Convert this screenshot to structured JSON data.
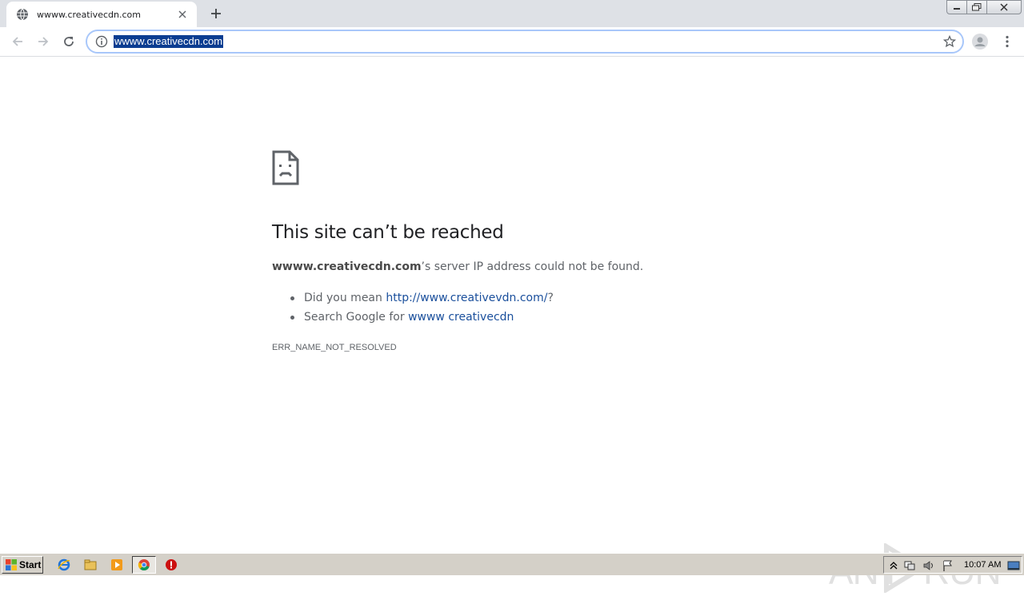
{
  "tab": {
    "title": "wwww.creativecdn.com"
  },
  "omnibox": {
    "url": "wwww.creativecdn.com"
  },
  "error": {
    "title": "This site can’t be reached",
    "host": "wwww.creativecdn.com",
    "desc_suffix": "’s server IP address could not be found.",
    "suggestion1_prefix": "Did you mean ",
    "suggestion1_link": "http://www.creativevdn.com/",
    "suggestion1_suffix": "?",
    "suggestion2_prefix": "Search Google for ",
    "suggestion2_link": "wwww creativecdn",
    "code": "ERR_NAME_NOT_RESOLVED"
  },
  "watermark": {
    "text_left": "ANY",
    "text_right": "RUN"
  },
  "taskbar": {
    "start_label": "Start",
    "clock": "10:07 AM"
  },
  "colors": {
    "accent": "#1a73e8",
    "link": "#1a4f9c",
    "selection": "#0b3d91",
    "text_secondary": "#5f6368"
  }
}
